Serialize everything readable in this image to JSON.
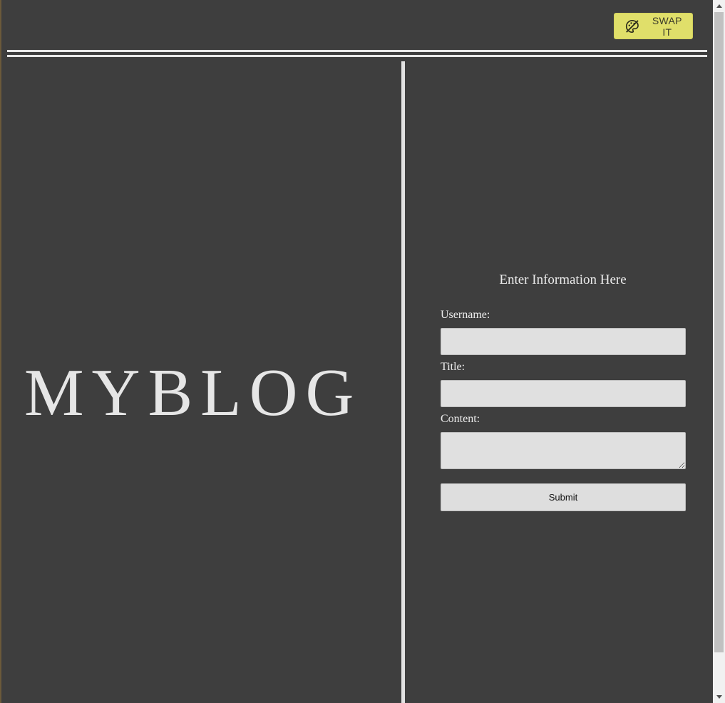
{
  "header": {
    "swap_button": {
      "label": "SWAP IT",
      "icon": "palette-off-icon",
      "background": "#e0df6a"
    }
  },
  "blog": {
    "title": "MYBLOG"
  },
  "form": {
    "heading": "Enter Information Here",
    "username": {
      "label": "Username:",
      "value": ""
    },
    "title": {
      "label": "Title:",
      "value": ""
    },
    "content": {
      "label": "Content:",
      "value": ""
    },
    "submit_label": "Submit"
  },
  "theme": {
    "page_background": "#3e3e3e",
    "text_color": "#e6e6e6",
    "rule_color": "#e8e8e8"
  }
}
